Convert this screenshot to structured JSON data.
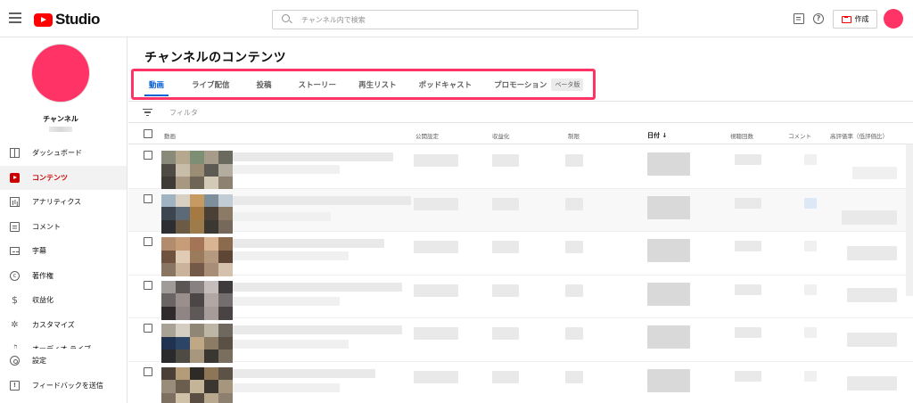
{
  "app": {
    "title": "Studio",
    "search_placeholder": "チャンネル内で検索",
    "create_label": "作成",
    "help_glyph": "?"
  },
  "sidebar": {
    "channel_name": "チャンネル",
    "items": [
      {
        "label": "ダッシュボード",
        "icon": "dashboard-icon"
      },
      {
        "label": "コンテンツ",
        "icon": "content-icon",
        "active": true
      },
      {
        "label": "アナリティクス",
        "icon": "analytics-icon"
      },
      {
        "label": "コメント",
        "icon": "comment-icon"
      },
      {
        "label": "字幕",
        "icon": "subtitles-icon"
      },
      {
        "label": "著作権",
        "icon": "copyright-icon"
      },
      {
        "label": "収益化",
        "icon": "monetize-icon"
      },
      {
        "label": "カスタマイズ",
        "icon": "customize-icon"
      },
      {
        "label": "オーディオ ライブ",
        "icon": "audio-library-icon"
      }
    ],
    "bottom_items": [
      {
        "label": "設定",
        "icon": "settings-icon"
      },
      {
        "label": "フィードバックを送信",
        "icon": "feedback-icon"
      }
    ],
    "icon_glyphs": {
      "copyright": "c",
      "monetize": "$",
      "customize": "✲",
      "audio": "♫"
    }
  },
  "main": {
    "page_title": "チャンネルのコンテンツ",
    "tabs": [
      {
        "label": "動画",
        "active": true
      },
      {
        "label": "ライブ配信"
      },
      {
        "label": "投稿"
      },
      {
        "label": "ストーリー"
      },
      {
        "label": "再生リスト"
      },
      {
        "label": "ポッドキャスト"
      },
      {
        "label": "プロモーション",
        "badge": "ベータ版"
      }
    ],
    "filter_label": "フィルタ",
    "columns": {
      "video": "動画",
      "visibility": "公開設定",
      "monetization": "収益化",
      "restrictions": "制限",
      "date": "日付 ↓",
      "views": "視聴回数",
      "comments": "コメント",
      "likes": "高評価率（低評価比）"
    }
  },
  "colors": {
    "brand_red": "#ff0000",
    "active_red": "#cc0000",
    "tab_blue": "#065fd4",
    "highlight_pink": "#ff3366",
    "avatar_pink": "#ff3366"
  }
}
